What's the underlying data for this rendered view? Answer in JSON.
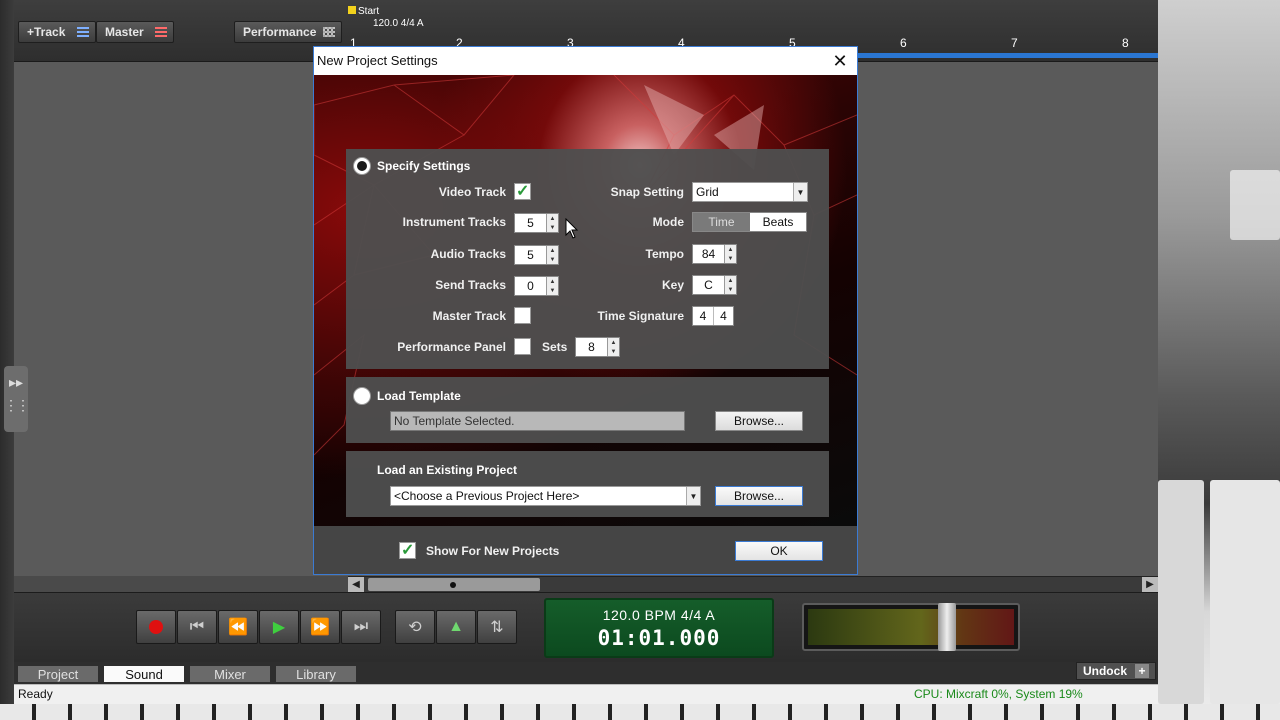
{
  "toolbar": {
    "track_button": "+Track",
    "master_button": "Master",
    "performance_button": "Performance"
  },
  "timeline": {
    "start_marker": "Start",
    "start_info": "120.0 4/4 A",
    "bars": [
      "1",
      "2",
      "3",
      "4",
      "5",
      "6",
      "7",
      "8"
    ]
  },
  "dialog": {
    "title": "New Project Settings",
    "specify": {
      "label": "Specify Settings",
      "video_track_label": "Video Track",
      "video_track_checked": true,
      "instrument_tracks_label": "Instrument Tracks",
      "instrument_tracks_value": "5",
      "audio_tracks_label": "Audio Tracks",
      "audio_tracks_value": "5",
      "send_tracks_label": "Send Tracks",
      "send_tracks_value": "0",
      "master_track_label": "Master Track",
      "master_track_checked": false,
      "performance_panel_label": "Performance Panel",
      "performance_panel_checked": false,
      "sets_label": "Sets",
      "sets_value": "8",
      "snap_setting_label": "Snap Setting",
      "snap_setting_value": "Grid",
      "mode_label": "Mode",
      "mode_time": "Time",
      "mode_beats": "Beats",
      "mode_selected": "Beats",
      "tempo_label": "Tempo",
      "tempo_value": "84",
      "key_label": "Key",
      "key_value": "C",
      "time_signature_label": "Time Signature",
      "time_signature_num": "4",
      "time_signature_den": "4"
    },
    "template": {
      "label": "Load Template",
      "field_value": "No Template Selected.",
      "browse": "Browse..."
    },
    "existing": {
      "label": "Load an Existing Project",
      "select_value": "<Choose a Previous Project Here>",
      "browse": "Browse..."
    },
    "show_for_new_label": "Show For New Projects",
    "show_for_new_checked": true,
    "ok": "OK"
  },
  "transport": {
    "tempo_line": "120.0 BPM  4/4    A",
    "time": "01:01.000"
  },
  "tabs": {
    "items": [
      "Project",
      "Sound",
      "Mixer",
      "Library"
    ],
    "active": "Sound",
    "undock": "Undock"
  },
  "status": {
    "ready": "Ready",
    "cpu": "CPU: Mixcraft 0%, System 19%"
  },
  "colors": {
    "accent_blue": "#3b7bd4",
    "lcd_green": "#155d2a",
    "cpu_text": "#1a8a1a",
    "record_red": "#e01010",
    "play_green": "#3fcf3f"
  }
}
